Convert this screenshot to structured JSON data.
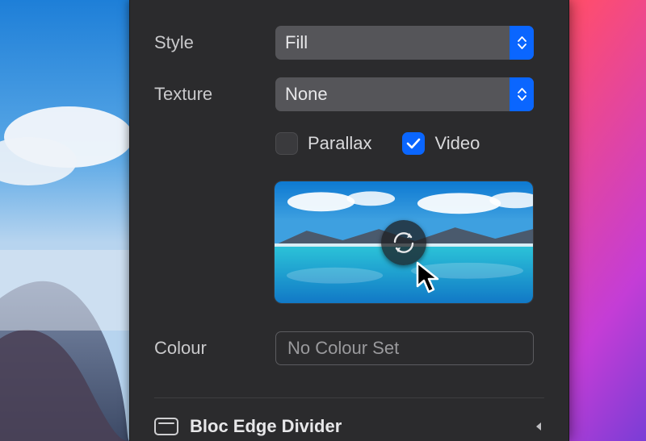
{
  "labels": {
    "style": "Style",
    "texture": "Texture",
    "colour": "Colour"
  },
  "style": {
    "value": "Fill"
  },
  "texture": {
    "value": "None"
  },
  "checks": {
    "parallax": {
      "label": "Parallax",
      "checked": false
    },
    "video": {
      "label": "Video",
      "checked": true
    }
  },
  "colour": {
    "placeholder": "No Colour Set"
  },
  "section": {
    "title": "Bloc Edge Divider"
  }
}
